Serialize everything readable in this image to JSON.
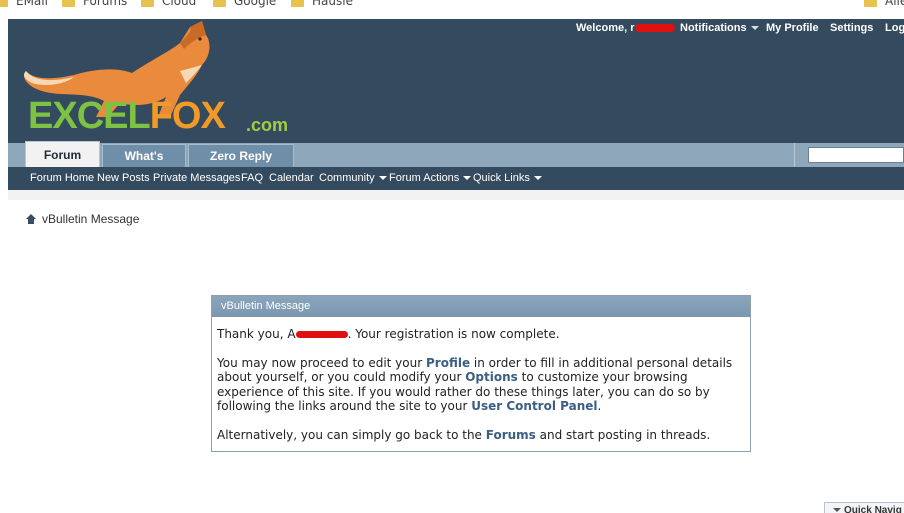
{
  "bookmarks": [
    {
      "label": "EMail"
    },
    {
      "label": "Forums"
    },
    {
      "label": "Cloud"
    },
    {
      "label": "Google"
    },
    {
      "label": "Hausle"
    },
    {
      "label": "Alle"
    }
  ],
  "header": {
    "welcome": "Welcome,",
    "username_visible": "r",
    "notifications": "Notifications",
    "my_profile": "My Profile",
    "settings": "Settings",
    "logout": "Log"
  },
  "logo": {
    "part1": "EXCEL",
    "part2": "FOX",
    "suffix": ".com"
  },
  "tabs": [
    {
      "label": "Forum",
      "active": true
    },
    {
      "label": "What's New?",
      "active": false
    },
    {
      "label": "Zero Reply Posts",
      "active": false
    }
  ],
  "nav": {
    "items": [
      {
        "label": "Forum Home"
      },
      {
        "label": "New Posts"
      },
      {
        "label": "Private Messages"
      },
      {
        "label": "FAQ"
      },
      {
        "label": "Calendar"
      },
      {
        "label": "Community"
      },
      {
        "label": "Forum Actions"
      },
      {
        "label": "Quick Links"
      }
    ]
  },
  "breadcrumb": {
    "label": "vBulletin Message"
  },
  "message": {
    "title": "vBulletin Message",
    "line1_prefix": "Thank you,",
    "line1_redacted": "A",
    "line1_suffix": "Your registration is now complete.",
    "p2_a": "You may now proceed to edit your",
    "p2_profile": "Profile",
    "p2_b": "in order to fill in additional personal details about yourself, or you could modify your",
    "p2_options": "Options",
    "p2_c": "to customize your browsing experience of this site. If you would rather do these things later, you can do so by following the links around the site to your",
    "p2_ucp": "User Control Panel",
    "p2_d": ".",
    "p3_a": "Alternatively, you can simply go back to the",
    "p3_forums": "Forums",
    "p3_b": "and start posting in threads."
  },
  "quick_navigation": {
    "label": "Quick Navig"
  },
  "colors": {
    "header_bg": "#344a5e",
    "tabbar_bg": "#8fa7bb",
    "link": "#3b5e83",
    "logo_green": "#7dc243",
    "logo_orange": "#f29a27"
  }
}
